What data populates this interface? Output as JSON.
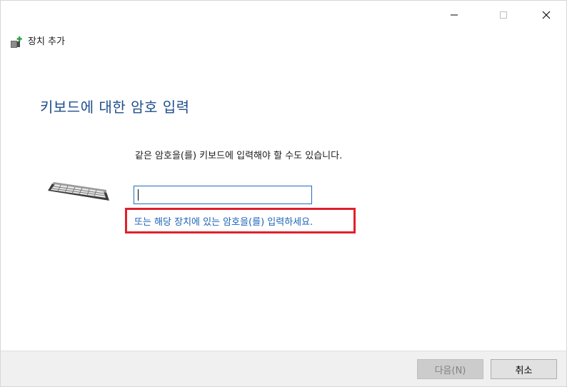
{
  "window": {
    "title": "장치 추가",
    "controls": {
      "minimize_icon": "minimize-icon",
      "maximize_icon": "maximize-icon",
      "close_icon": "close-icon"
    }
  },
  "main": {
    "heading": "키보드에 대한 암호 입력",
    "instruction": "같은 암호을(를) 키보드에 입력해야 할 수도 있습니다.",
    "pin_input": {
      "value": "",
      "placeholder": ""
    },
    "device_link": "또는 해당 장치에 있는 암호을(를) 입력하세요.",
    "image_icon": "keyboard-icon"
  },
  "footer": {
    "next_label": "다음(N)",
    "cancel_label": "취소"
  },
  "colors": {
    "heading": "#1f4e8c",
    "link": "#1a63b8",
    "highlight": "#e0202b",
    "input_border": "#1f6dbf"
  }
}
